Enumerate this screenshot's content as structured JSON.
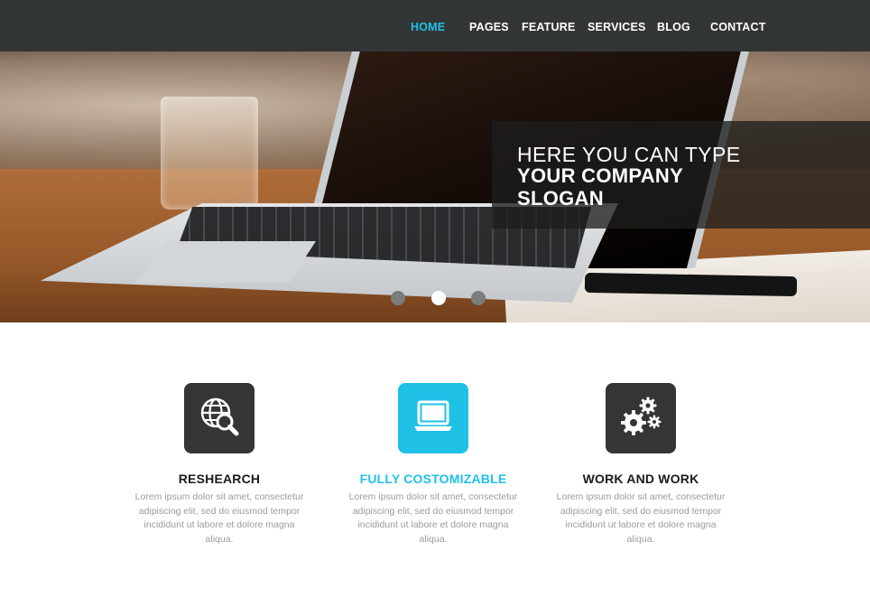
{
  "nav": {
    "items": [
      {
        "label": "HOME",
        "active": true
      },
      {
        "label": "PAGES",
        "active": false
      },
      {
        "label": "FEATURE",
        "active": false
      },
      {
        "label": "SERVICES",
        "active": false
      },
      {
        "label": "BLOG",
        "active": false
      },
      {
        "label": "CONTACT",
        "active": false
      }
    ]
  },
  "hero": {
    "slogan_line1": "HERE YOU CAN TYPE",
    "slogan_line2": "YOUR COMPANY SLOGAN",
    "slides": {
      "count": 3,
      "active_index": 1
    }
  },
  "features": [
    {
      "icon": "globe-search-icon",
      "title": "RESHEARCH",
      "text": "Lorem ipsum dolor sit amet, consectetur adipiscing elit, sed do eiusmod tempor incididunt ut labore et dolore magna aliqua.",
      "highlight": false
    },
    {
      "icon": "laptop-icon",
      "title": "FULLY COSTOMIZABLE",
      "text": "Lorem ipsum dolor sit amet, consectetur adipiscing elit, sed do eiusmod tempor incididunt ut labore et dolore magna aliqua.",
      "highlight": true
    },
    {
      "icon": "gears-icon",
      "title": "WORK AND WORK",
      "text": "Lorem ipsum dolor sit amet, consectetur adipiscing elit, sed do eiusmod tempor incididunt ut labore et dolore magna aliqua.",
      "highlight": false
    }
  ],
  "colors": {
    "accent": "#1fc1e7",
    "nav_bg": "#323536",
    "icon_bg": "#333536",
    "body_text": "#9b9b9b"
  }
}
